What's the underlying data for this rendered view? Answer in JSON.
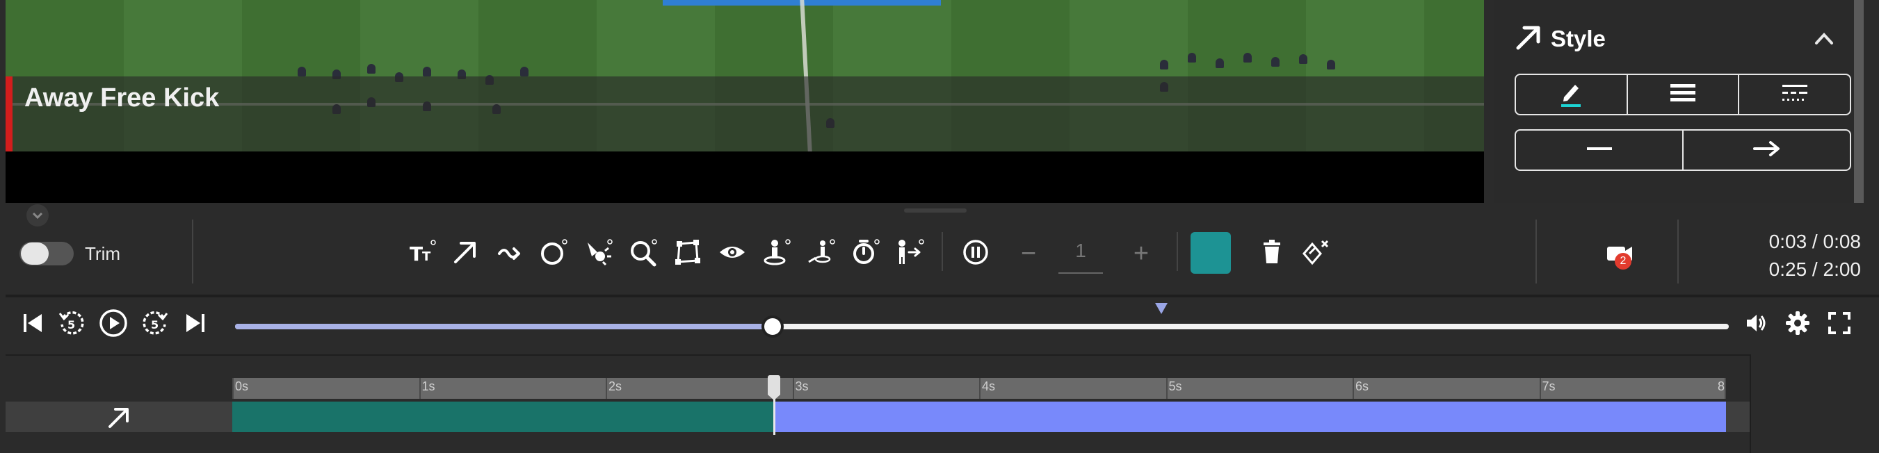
{
  "video": {
    "overlay_title": "Away Free Kick"
  },
  "style_panel": {
    "title": "Style",
    "title_icon": "arrow-icon",
    "collapse_icon": "chevron-up-icon",
    "row1": [
      "pen-color-icon",
      "line-weight-icon",
      "line-dash-icon"
    ],
    "row2": [
      "line-end-plain-icon",
      "line-end-arrow-icon"
    ],
    "pen_underline_color": "#1dd3d3"
  },
  "toolbar": {
    "trim_label": "Trim",
    "trim_on": false,
    "tools": [
      "text-tool-icon",
      "arrow-tool-icon",
      "curved-arrow-tool-icon",
      "circle-tool-icon",
      "spotlight-tool-icon",
      "magnifier-tool-icon",
      "polygon-tool-icon",
      "eye-tool-icon",
      "player-marker-tool-icon",
      "player-connect-tool-icon",
      "timer-tool-icon",
      "player-move-tool-icon"
    ],
    "pause_icon": "pause-icon",
    "stepper": {
      "minus": "−",
      "value": "1",
      "plus": "+"
    },
    "color": "#1d9394",
    "delete_icon": "trash-icon",
    "clear_icon": "clear-all-icon",
    "camera_badge": "2",
    "time_clip": "0:03 / 0:08",
    "time_total": "0:25 / 2:00"
  },
  "player": {
    "progress": 0.36,
    "marker_position": 0.62,
    "controls": [
      "skip-start-icon",
      "rewind-5-icon",
      "play-icon",
      "forward-5-icon",
      "skip-end-icon"
    ],
    "rewind_label": "5",
    "forward_label": "5"
  },
  "timeline": {
    "duration_s": 8,
    "ticks": [
      "0s",
      "1s",
      "2s",
      "3s",
      "4s",
      "5s",
      "6s",
      "7s",
      "8"
    ],
    "playhead_s": 2.9,
    "clip_start_s": 0,
    "clip_end_s": 8,
    "track_icon": "arrow-icon",
    "played_color": "#197369",
    "clip_color": "#7889fb"
  }
}
